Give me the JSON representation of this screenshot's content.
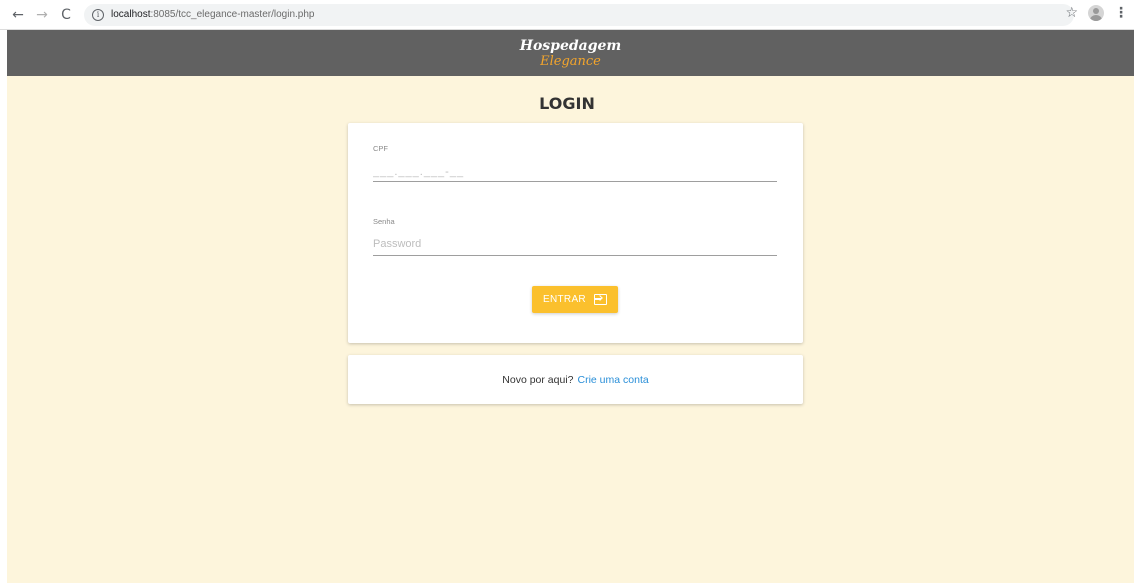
{
  "browser": {
    "url_host": "localhost",
    "url_rest": ":8085/tcc_elegance-master/login.php",
    "back_glyph": "←",
    "forward_glyph": "→",
    "reload_glyph": "C",
    "info_glyph": "i",
    "star_glyph": "☆",
    "menu_glyph": "⋮"
  },
  "header": {
    "brand_line1": "Hospedagem",
    "brand_line2": "Elegance"
  },
  "login": {
    "title": "LOGIN",
    "cpf_label": "CPF",
    "cpf_placeholder": "___.___.___-__",
    "password_label": "Senha",
    "password_placeholder": "Password",
    "submit_label": "ENTRAR"
  },
  "signup": {
    "prompt": "Novo por aqui?",
    "link": "Crie uma conta"
  },
  "colors": {
    "page_bg": "#fdf5dc",
    "header_bg": "#616161",
    "brand_accent": "#f3a52c",
    "button_bg": "#fbc02d",
    "link": "#2a8fd8"
  }
}
